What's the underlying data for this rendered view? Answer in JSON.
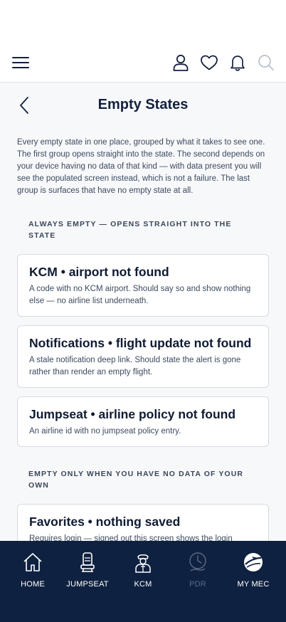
{
  "topbar": {
    "icons": [
      "hamburger-menu-icon",
      "profile-icon",
      "heart-icon",
      "bell-icon",
      "search-icon"
    ]
  },
  "page": {
    "title": "Empty States",
    "intro": "Every empty state in one place, grouped by what it takes to see one. The first group opens straight into the state. The second depends on your device having no data of that kind — with data present you will see the populated screen instead, which is not a failure. The last group is surfaces that have no empty state at all."
  },
  "sections": [
    {
      "heading": "ALWAYS EMPTY — OPENS STRAIGHT INTO THE STATE",
      "cards": [
        {
          "title": "KCM • airport not found",
          "desc": "A code with no KCM airport. Should say so and show nothing else — no airline list underneath."
        },
        {
          "title": "Notifications • flight update not found",
          "desc": "A stale notification deep link. Should state the alert is gone rather than render an empty flight."
        },
        {
          "title": "Jumpseat • airline policy not found",
          "desc": "An airline id with no jumpseat policy entry."
        }
      ]
    },
    {
      "heading": "EMPTY ONLY WHEN YOU HAVE NO DATA OF YOUR OWN",
      "cards": [
        {
          "title": "Favorites • nothing saved",
          "desc": "Requires login — signed out this screen shows the login prompt instead. Once signed in with nothing favourited, the empty state shows. A second variant covers favorites failing to load."
        }
      ]
    }
  ],
  "tabbar": {
    "tabs": [
      {
        "label": "HOME",
        "icon": "house-icon",
        "enabled": true
      },
      {
        "label": "JUMPSEAT",
        "icon": "seat-icon",
        "enabled": true
      },
      {
        "label": "KCM",
        "icon": "pilot-icon",
        "enabled": true
      },
      {
        "label": "PDR",
        "icon": "clock-plane-icon",
        "enabled": false
      },
      {
        "label": "MY MEC",
        "icon": "globe-plane-icon",
        "enabled": true
      }
    ]
  },
  "colors": {
    "navy": "#0f2140",
    "text": "#14213d",
    "disabled_tab": "#5b6a83",
    "card_border": "#d6dbe2"
  }
}
